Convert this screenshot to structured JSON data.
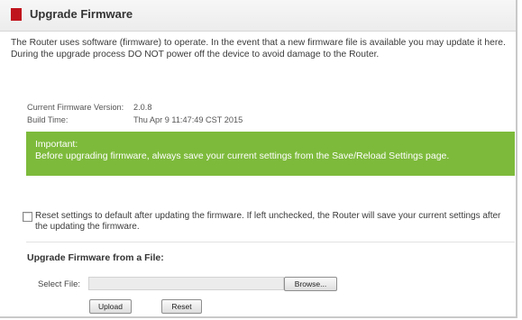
{
  "header": {
    "title": "Upgrade Firmware"
  },
  "intro": {
    "text": "The Router uses software (firmware) to operate. In the event that a new firmware file is available you may update it here. During the upgrade process DO NOT power off the device to avoid damage to the Router."
  },
  "info": {
    "firmware_label": "Current Firmware Version:",
    "firmware_value": "2.0.8",
    "build_label": "Build Time:",
    "build_value": "Thu Apr 9 11:47:49 CST 2015"
  },
  "important": {
    "title": "Important:",
    "text": "Before upgrading firmware, always save your current settings from the Save/Reload Settings page.",
    "color": "#7dba3b"
  },
  "reset_option": {
    "checked": false,
    "text": "Reset settings to default after updating the firmware. If left unchecked, the Router will save your current settings after the updating the firmware."
  },
  "upload_section": {
    "title": "Upgrade Firmware from a File:",
    "select_label": "Select File:",
    "file_value": "",
    "browse_label": "Browse...",
    "upload_label": "Upload",
    "reset_label": "Reset"
  },
  "colors": {
    "accent_marker": "#c0141c"
  }
}
